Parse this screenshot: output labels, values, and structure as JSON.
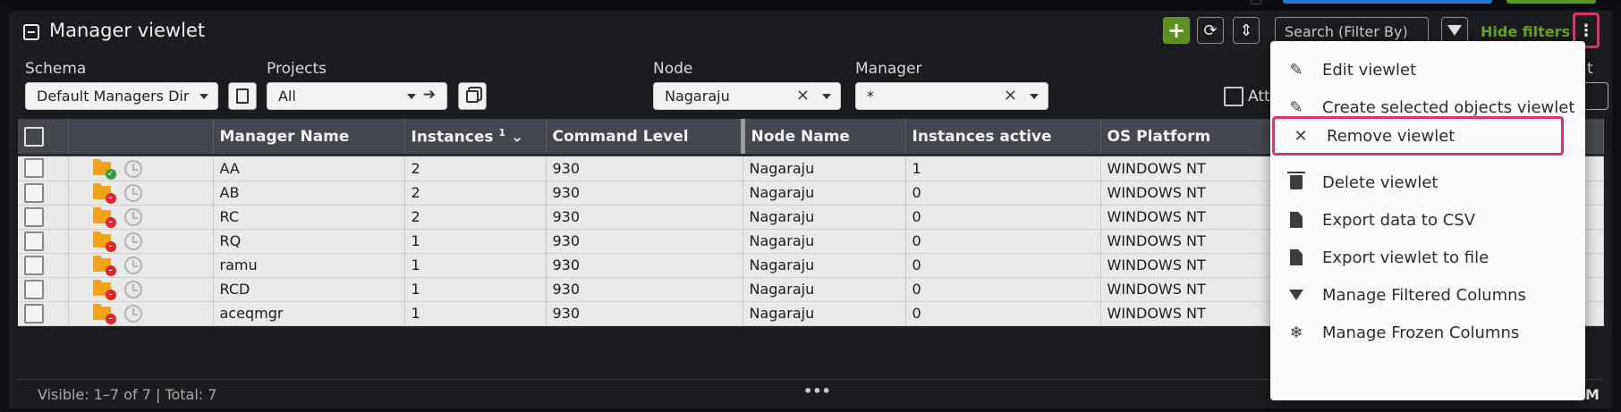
{
  "window": {
    "title": "Manager viewlet"
  },
  "toolbar": {
    "search_placeholder": "Search (Filter By)",
    "hide_filters_label": "Hide filters",
    "add_icon": "+",
    "refresh_icon": "⟳",
    "sort_icon": "⇕",
    "filter_icon": "funnel-icon",
    "kebab_icon": "⋮"
  },
  "filters": {
    "schema": {
      "label": "Schema",
      "value": "Default Managers Dir"
    },
    "projects": {
      "label": "Projects",
      "value": "All"
    },
    "node": {
      "label": "Node",
      "value": "Nagaraju"
    },
    "manager": {
      "label": "Manager",
      "value": "*"
    },
    "attr_label": "Attr",
    "right_label": "t"
  },
  "table": {
    "columns": [
      "Manager Name",
      "Instances",
      "Command Level",
      "Node Name",
      "Instances active",
      "OS Platform"
    ],
    "sort_index": "1",
    "rows": [
      {
        "status": "ok",
        "name": "AA",
        "instances": "2",
        "command_level": "930",
        "node": "Nagaraju",
        "active": "1",
        "os": "WINDOWS NT"
      },
      {
        "status": "bad",
        "name": "AB",
        "instances": "2",
        "command_level": "930",
        "node": "Nagaraju",
        "active": "0",
        "os": "WINDOWS NT"
      },
      {
        "status": "bad",
        "name": "RC",
        "instances": "2",
        "command_level": "930",
        "node": "Nagaraju",
        "active": "0",
        "os": "WINDOWS NT"
      },
      {
        "status": "bad",
        "name": "RQ",
        "instances": "1",
        "command_level": "930",
        "node": "Nagaraju",
        "active": "0",
        "os": "WINDOWS NT"
      },
      {
        "status": "bad",
        "name": "ramu",
        "instances": "1",
        "command_level": "930",
        "node": "Nagaraju",
        "active": "0",
        "os": "WINDOWS NT"
      },
      {
        "status": "bad",
        "name": "RCD",
        "instances": "1",
        "command_level": "930",
        "node": "Nagaraju",
        "active": "0",
        "os": "WINDOWS NT"
      },
      {
        "status": "bad",
        "name": "aceqmgr",
        "instances": "1",
        "command_level": "930",
        "node": "Nagaraju",
        "active": "0",
        "os": "WINDOWS NT"
      }
    ]
  },
  "footer": {
    "visible_text": "Visible: 1–7 of 7 | Total: 7",
    "corner": "M"
  },
  "menu": {
    "items": [
      {
        "label": "Edit viewlet",
        "icon": "edit-icon"
      },
      {
        "label": "Create selected objects viewlet",
        "icon": "edit-icon"
      },
      {
        "label": "Remove viewlet",
        "icon": "close-icon"
      },
      {
        "label": "Delete viewlet",
        "icon": "trash-icon"
      },
      {
        "label": "Export data to CSV",
        "icon": "file-icon"
      },
      {
        "label": "Export viewlet to file",
        "icon": "file-icon"
      },
      {
        "label": "Manage Filtered Columns",
        "icon": "funnel-icon"
      },
      {
        "label": "Manage Frozen Columns",
        "icon": "snowflake-icon"
      }
    ]
  },
  "colors": {
    "accent_green": "#6aa022",
    "highlight": "#e0336b",
    "header_bg": "#44474e"
  }
}
